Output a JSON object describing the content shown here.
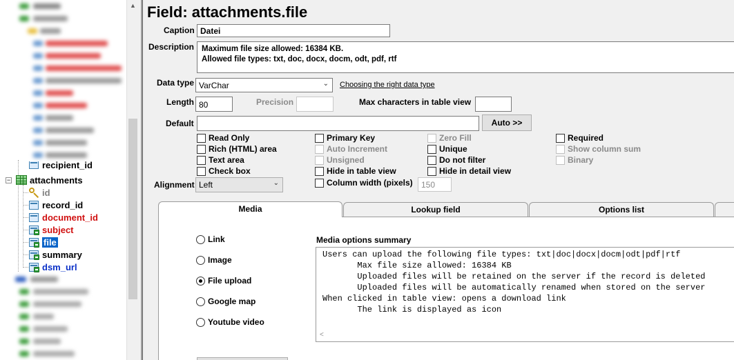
{
  "tree": {
    "items": [
      {
        "label": "recipient_id",
        "kind": "field",
        "color": "#000000"
      },
      {
        "label": "attachments",
        "kind": "table",
        "color": "#000000"
      },
      {
        "label": "id",
        "kind": "key",
        "color": "#808080"
      },
      {
        "label": "record_id",
        "kind": "field",
        "color": "#000000"
      },
      {
        "label": "document_id",
        "kind": "field",
        "color": "#d01010"
      },
      {
        "label": "subject",
        "kind": "field-badge",
        "color": "#d01010"
      },
      {
        "label": "file",
        "kind": "field-badge",
        "color": "#ffffff",
        "selected": true
      },
      {
        "label": "summary",
        "kind": "field-badge",
        "color": "#000000"
      },
      {
        "label": "dsm_url",
        "kind": "field-badge",
        "color": "#0a30c8"
      }
    ]
  },
  "main": {
    "title": "Field: attachments.file",
    "caption_label": "Caption",
    "caption_value": "Datei",
    "description_label": "Description",
    "description_lines": [
      "Maximum file size allowed: 16384 KB.",
      "Allowed file types: txt, doc, docx, docm, odt, pdf, rtf"
    ],
    "datatype_label": "Data type",
    "datatype_value": "VarChar",
    "datatype_help_link": "Choosing the right data type",
    "length_label": "Length",
    "length_value": "80",
    "precision_label": "Precision",
    "precision_value": "",
    "maxchars_label": "Max characters in table view",
    "maxchars_value": "",
    "default_label": "Default",
    "default_value": "",
    "auto_button": "Auto >>",
    "alignment_label": "Alignment",
    "alignment_value": "Left",
    "column_width_label": "Column width (pixels)",
    "column_width_value": "150",
    "checkboxes": {
      "read_only": {
        "label": "Read Only",
        "checked": false,
        "enabled": true
      },
      "rich_html": {
        "label": "Rich (HTML) area",
        "checked": false,
        "enabled": true
      },
      "text_area": {
        "label": "Text area",
        "checked": false,
        "enabled": true
      },
      "check_box": {
        "label": "Check box",
        "checked": false,
        "enabled": true
      },
      "primary_key": {
        "label": "Primary Key",
        "checked": false,
        "enabled": true
      },
      "auto_increment": {
        "label": "Auto Increment",
        "checked": false,
        "enabled": false
      },
      "unsigned": {
        "label": "Unsigned",
        "checked": false,
        "enabled": false
      },
      "hide_table": {
        "label": "Hide in table view",
        "checked": false,
        "enabled": true
      },
      "column_width": {
        "label": "Column width (pixels)",
        "checked": false,
        "enabled": true
      },
      "zero_fill": {
        "label": "Zero Fill",
        "checked": false,
        "enabled": false
      },
      "unique": {
        "label": "Unique",
        "checked": false,
        "enabled": true
      },
      "do_not_filter": {
        "label": "Do not filter",
        "checked": false,
        "enabled": true
      },
      "hide_detail": {
        "label": "Hide in detail view",
        "checked": false,
        "enabled": true
      },
      "required": {
        "label": "Required",
        "checked": false,
        "enabled": true
      },
      "show_sum": {
        "label": "Show column sum",
        "checked": false,
        "enabled": false
      },
      "binary": {
        "label": "Binary",
        "checked": false,
        "enabled": false
      }
    },
    "tabs": [
      {
        "label": "Media",
        "active": true
      },
      {
        "label": "Lookup field",
        "active": false
      },
      {
        "label": "Options list",
        "active": false
      }
    ],
    "media": {
      "options": [
        {
          "label": "Link",
          "selected": false
        },
        {
          "label": "Image",
          "selected": false
        },
        {
          "label": "File upload",
          "selected": true
        },
        {
          "label": "Google map",
          "selected": false
        },
        {
          "label": "Youtube video",
          "selected": false
        }
      ],
      "summary_title": "Media options summary",
      "summary_lines": [
        "Users can upload the following file types: txt|doc|docx|docm|odt|pdf|rtf",
        "       Max file size allowed: 16384 KB",
        "       Uploaded files will be retained on the server if the record is deleted",
        "       Uploaded files will be automatically renamed when stored on the server",
        "When clicked in table view: opens a download link",
        "       The link is displayed as icon"
      ]
    }
  }
}
